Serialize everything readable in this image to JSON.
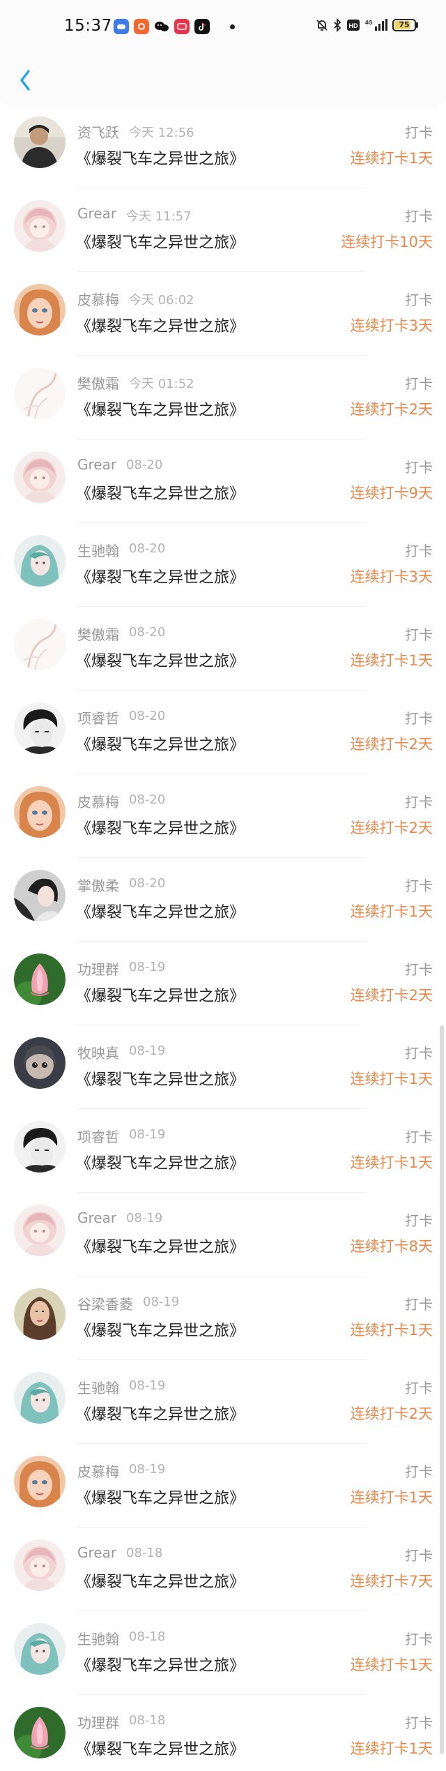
{
  "status_bar": {
    "time": "15:37",
    "battery": "75",
    "network": "4G"
  },
  "nav": {
    "back_icon": "chevron-left-icon"
  },
  "entries": [
    {
      "name": "资飞跃",
      "time": "今天 12:56",
      "book": "《爆裂飞车之异世之旅》",
      "action": "打卡",
      "streak": "连续打卡1天",
      "avatar": "man-dark"
    },
    {
      "name": "Grear",
      "time": "今天 11:57",
      "book": "《爆裂飞车之异世之旅》",
      "action": "打卡",
      "streak": "连续打卡10天",
      "avatar": "pink-girl"
    },
    {
      "name": "皮慕梅",
      "time": "今天 06:02",
      "book": "《爆裂飞车之异世之旅》",
      "action": "打卡",
      "streak": "连续打卡3天",
      "avatar": "doll"
    },
    {
      "name": "樊傲霜",
      "time": "今天 01:52",
      "book": "《爆裂飞车之异世之旅》",
      "action": "打卡",
      "streak": "连续打卡2天",
      "avatar": "sketch"
    },
    {
      "name": "Grear",
      "time": "08-20",
      "book": "《爆裂飞车之异世之旅》",
      "action": "打卡",
      "streak": "连续打卡9天",
      "avatar": "pink-girl"
    },
    {
      "name": "生驰翰",
      "time": "08-20",
      "book": "《爆裂飞车之异世之旅》",
      "action": "打卡",
      "streak": "连续打卡3天",
      "avatar": "teal-girl"
    },
    {
      "name": "樊傲霜",
      "time": "08-20",
      "book": "《爆裂飞车之异世之旅》",
      "action": "打卡",
      "streak": "连续打卡1天",
      "avatar": "sketch"
    },
    {
      "name": "项睿哲",
      "time": "08-20",
      "book": "《爆裂飞车之异世之旅》",
      "action": "打卡",
      "streak": "连续打卡2天",
      "avatar": "bw-boy"
    },
    {
      "name": "皮慕梅",
      "time": "08-20",
      "book": "《爆裂飞车之异世之旅》",
      "action": "打卡",
      "streak": "连续打卡2天",
      "avatar": "doll"
    },
    {
      "name": "掌傲柔",
      "time": "08-20",
      "book": "《爆裂飞车之异世之旅》",
      "action": "打卡",
      "streak": "连续打卡1天",
      "avatar": "girl-photo"
    },
    {
      "name": "功理群",
      "time": "08-19",
      "book": "《爆裂飞车之异世之旅》",
      "action": "打卡",
      "streak": "连续打卡2天",
      "avatar": "lotus"
    },
    {
      "name": "牧映真",
      "time": "08-19",
      "book": "《爆裂飞车之异世之旅》",
      "action": "打卡",
      "streak": "连续打卡1天",
      "avatar": "anime-dark"
    },
    {
      "name": "项睿哲",
      "time": "08-19",
      "book": "《爆裂飞车之异世之旅》",
      "action": "打卡",
      "streak": "连续打卡1天",
      "avatar": "bw-boy"
    },
    {
      "name": "Grear",
      "time": "08-19",
      "book": "《爆裂飞车之异世之旅》",
      "action": "打卡",
      "streak": "连续打卡8天",
      "avatar": "pink-girl"
    },
    {
      "name": "谷梁香菱",
      "time": "08-19",
      "book": "《爆裂飞车之异世之旅》",
      "action": "打卡",
      "streak": "连续打卡1天",
      "avatar": "woman-photo"
    },
    {
      "name": "生驰翰",
      "time": "08-19",
      "book": "《爆裂飞车之异世之旅》",
      "action": "打卡",
      "streak": "连续打卡2天",
      "avatar": "teal-girl"
    },
    {
      "name": "皮慕梅",
      "time": "08-19",
      "book": "《爆裂飞车之异世之旅》",
      "action": "打卡",
      "streak": "连续打卡1天",
      "avatar": "doll"
    },
    {
      "name": "Grear",
      "time": "08-18",
      "book": "《爆裂飞车之异世之旅》",
      "action": "打卡",
      "streak": "连续打卡7天",
      "avatar": "pink-girl"
    },
    {
      "name": "生驰翰",
      "time": "08-18",
      "book": "《爆裂飞车之异世之旅》",
      "action": "打卡",
      "streak": "连续打卡1天",
      "avatar": "teal-girl"
    },
    {
      "name": "功理群",
      "time": "08-18",
      "book": "《爆裂飞车之异世之旅》",
      "action": "打卡",
      "streak": "连续打卡1天",
      "avatar": "lotus"
    }
  ],
  "colors": {
    "accent": "#1aa3e8",
    "streak": "#e8874a",
    "muted": "#999999"
  }
}
